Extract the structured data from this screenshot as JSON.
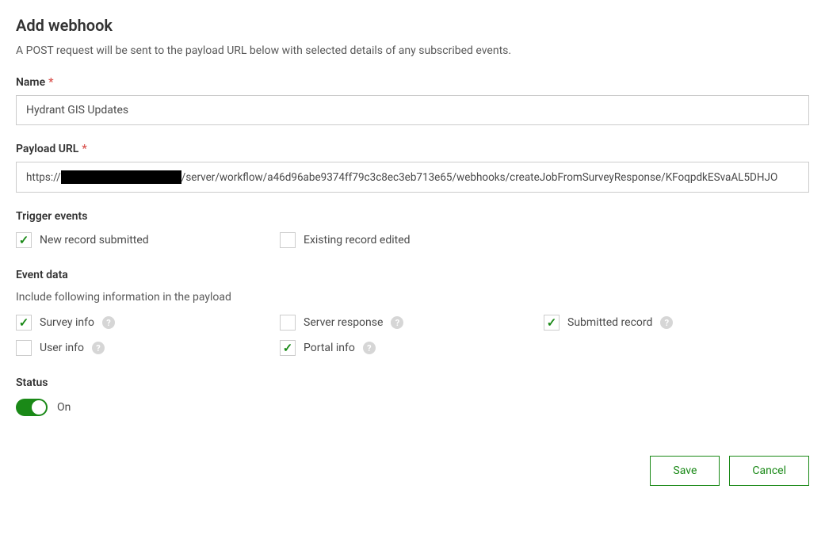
{
  "header": {
    "title": "Add webhook",
    "subtitle": "A POST request will be sent to the payload URL below with selected details of any subscribed events."
  },
  "fields": {
    "name_label": "Name",
    "name_value": "Hydrant GIS Updates",
    "payload_label": "Payload URL",
    "payload_prefix": "https://",
    "payload_suffix": "/server/workflow/a46d96abe9374ff79c3c8ec3eb713e65/webhooks/createJobFromSurveyResponse/KFoqpdkESvaAL5DHJO"
  },
  "trigger": {
    "label": "Trigger events",
    "options": {
      "new_record": "New record submitted",
      "existing_record": "Existing record edited"
    }
  },
  "event_data": {
    "label": "Event data",
    "sublabel": "Include following information in the payload",
    "options": {
      "survey_info": "Survey info",
      "server_response": "Server response",
      "submitted_record": "Submitted record",
      "user_info": "User info",
      "portal_info": "Portal info"
    }
  },
  "status": {
    "label": "Status",
    "value_label": "On"
  },
  "footer": {
    "save": "Save",
    "cancel": "Cancel"
  },
  "required_marker": "*",
  "help_marker": "?"
}
